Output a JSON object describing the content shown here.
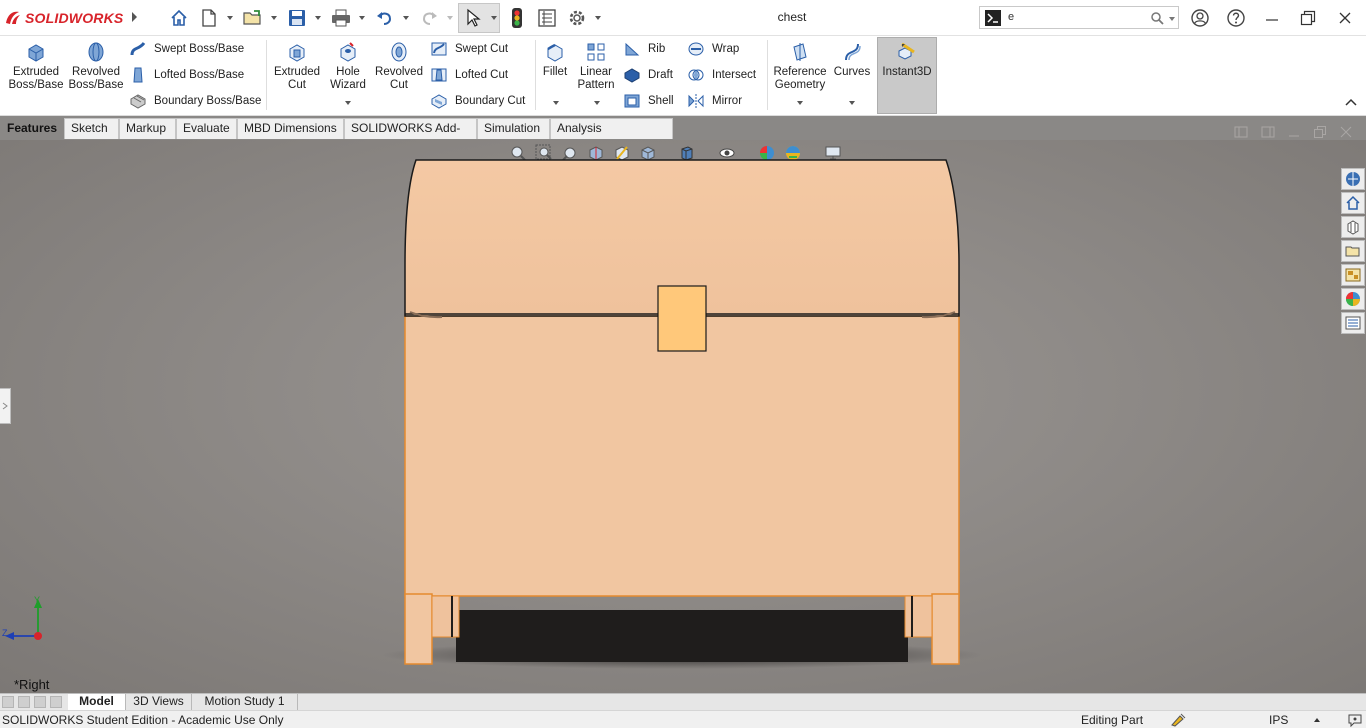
{
  "app": {
    "brand": "SOLIDWORKS",
    "document_title": "chest"
  },
  "search": {
    "value": "e"
  },
  "quick_access": {
    "icons": [
      "home-icon",
      "new-document-icon",
      "open-icon",
      "save-icon",
      "print-icon",
      "undo-icon",
      "redo-icon",
      "select-icon",
      "rebuild-icon",
      "file-properties-icon",
      "options-icon"
    ]
  },
  "ribbon": {
    "extruded_boss": "Extruded\nBoss/Base",
    "revolved_boss": "Revolved\nBoss/Base",
    "swept_boss": "Swept Boss/Base",
    "lofted_boss": "Lofted Boss/Base",
    "boundary_boss": "Boundary Boss/Base",
    "extruded_cut": "Extruded\nCut",
    "hole_wizard": "Hole\nWizard",
    "revolved_cut": "Revolved\nCut",
    "swept_cut": "Swept Cut",
    "lofted_cut": "Lofted Cut",
    "boundary_cut": "Boundary Cut",
    "fillet": "Fillet",
    "linear_pattern": "Linear\nPattern",
    "rib": "Rib",
    "draft": "Draft",
    "shell": "Shell",
    "wrap": "Wrap",
    "intersect": "Intersect",
    "mirror": "Mirror",
    "reference_geometry": "Reference\nGeometry",
    "curves": "Curves",
    "instant3d": "Instant3D"
  },
  "command_tabs": [
    "Features",
    "Sketch",
    "Markup",
    "Evaluate",
    "MBD Dimensions",
    "SOLIDWORKS Add-Ins",
    "Simulation",
    "Analysis Preparation"
  ],
  "viewport": {
    "view_name": "*Right",
    "triad": {
      "y": "Y",
      "z": "Z"
    }
  },
  "model_tabs": [
    "Model",
    "3D Views",
    "Motion Study 1"
  ],
  "status": {
    "left": "SOLIDWORKS Student Edition - Academic Use Only",
    "mode": "Editing Part",
    "units": "IPS"
  },
  "colors": {
    "accent_red": "#d8232a",
    "viewport_bg": "#8f8b88",
    "wood": "#f2c7a0",
    "latch": "#ffc87a",
    "selection_orange": "#e58a2e"
  }
}
